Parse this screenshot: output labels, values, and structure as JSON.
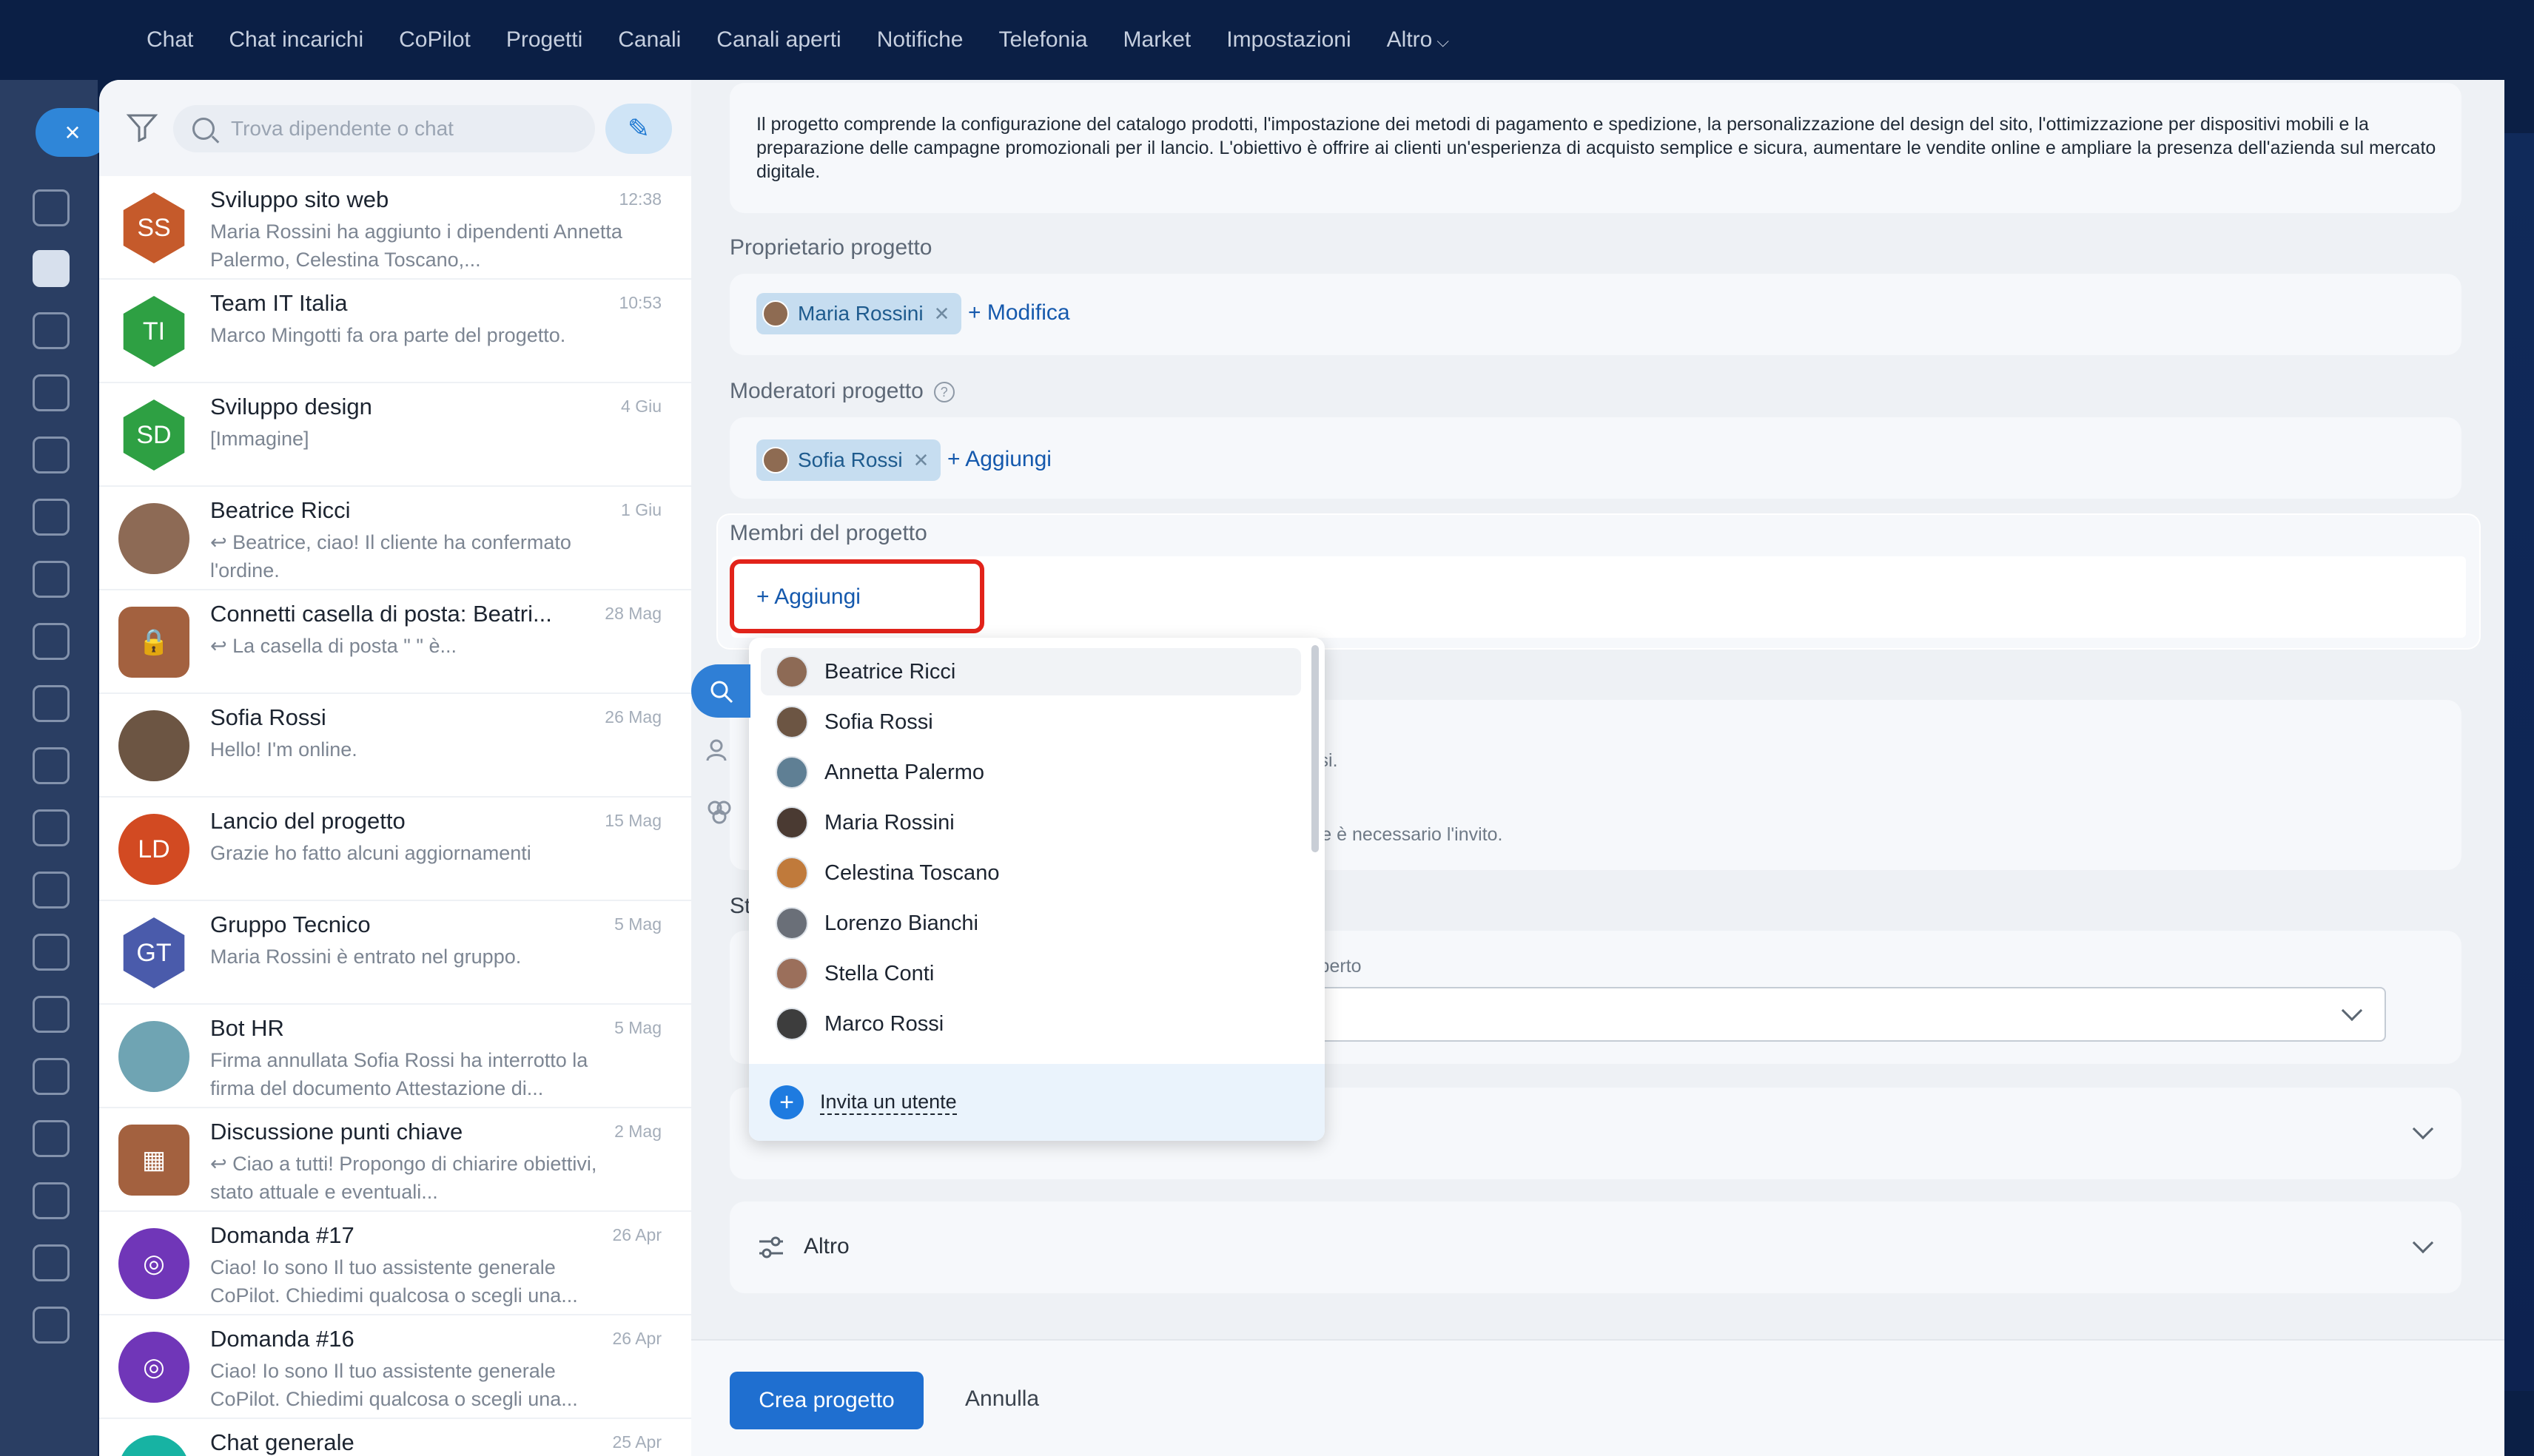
{
  "nav": {
    "items": [
      "Chat",
      "Chat incarichi",
      "CoPilot",
      "Progetti",
      "Canali",
      "Canali aperti",
      "Notifiche",
      "Telefonia",
      "Market",
      "Impostazioni",
      "Altro"
    ]
  },
  "rail": {
    "close": "×"
  },
  "search": {
    "placeholder": "Trova dipendente o chat"
  },
  "chats": [
    {
      "initials": "SS",
      "title": "Sviluppo sito web",
      "time": "12:38",
      "preview": "Maria Rossini ha aggiunto i dipendenti Annetta Palermo, Celestina Toscano,...",
      "color": "#c55a2b",
      "shape": "hex"
    },
    {
      "initials": "TI",
      "title": "Team IT Italia",
      "time": "10:53",
      "preview": "Marco Mingotti fa ora parte del progetto.",
      "color": "#2ea043",
      "shape": "hex"
    },
    {
      "initials": "SD",
      "title": "Sviluppo design",
      "time": "4 Giu",
      "preview": "[Immagine]",
      "color": "#2ea043",
      "shape": "hex"
    },
    {
      "initials": "",
      "title": "Beatrice Ricci",
      "time": "1 Giu",
      "preview": "↩ Beatrice, ciao! Il cliente ha confermato l'ordine.",
      "color": "#8d6a55",
      "shape": "circle"
    },
    {
      "initials": "🔒",
      "title": "Connetti casella di posta: Beatri...",
      "time": "28 Mag",
      "preview": "↩ La casella di posta \"                                   \" è...",
      "color": "#a3613f",
      "shape": "square"
    },
    {
      "initials": "",
      "title": "Sofia Rossi",
      "time": "26 Mag",
      "preview": "Hello! I'm online.",
      "color": "#6c5543",
      "shape": "circle"
    },
    {
      "initials": "LD",
      "title": "Lancio del progetto",
      "time": "15 Mag",
      "preview": "Grazie ho fatto alcuni aggiornamenti",
      "color": "#d24a22",
      "shape": "circle"
    },
    {
      "initials": "GT",
      "title": "Gruppo Tecnico",
      "time": "5 Mag",
      "preview": "Maria Rossini è entrato nel gruppo.",
      "color": "#4a5bab",
      "shape": "hex"
    },
    {
      "initials": "",
      "title": "Bot HR",
      "time": "5 Mag",
      "preview": "Firma annullata Sofia Rossi ha interrotto la firma del documento Attestazione di...",
      "color": "#6fa4b3",
      "shape": "circle"
    },
    {
      "initials": "▦",
      "title": "Discussione punti chiave",
      "time": "2 Mag",
      "preview": "↩ Ciao a tutti! Propongo di chiarire obiettivi, stato attuale e eventuali...",
      "color": "#a3613f",
      "shape": "square"
    },
    {
      "initials": "◎",
      "title": "Domanda #17",
      "time": "26 Apr",
      "preview": "Ciao! Io sono Il tuo assistente generale CoPilot. Chiedimi qualcosa o scegli una...",
      "color": "#7036b8",
      "shape": "circle"
    },
    {
      "initials": "◎",
      "title": "Domanda #16",
      "time": "26 Apr",
      "preview": "Ciao! Io sono Il tuo assistente generale CoPilot. Chiedimi qualcosa o scegli una...",
      "color": "#7036b8",
      "shape": "circle"
    },
    {
      "initials": "",
      "title": "Chat generale",
      "time": "25 Apr",
      "preview": "",
      "color": "#17b3a3",
      "shape": "circle"
    }
  ],
  "form": {
    "description": "Il progetto comprende la configurazione del catalogo prodotti, l'impostazione dei metodi di pagamento e spedizione, la personalizzazione del design del sito, l'ottimizzazione per dispositivi mobili e la preparazione delle campagne promozionali per il lancio. L'obiettivo è offrire ai clienti un'esperienza di acquisto semplice e sicura, aumentare le vendite online e ampliare la presenza dell'azienda sul mercato digitale.",
    "owner_label": "Proprietario progetto",
    "owner_name": "Maria Rossini",
    "owner_edit": "+ Modifica",
    "moderators_label": "Moderatori progetto",
    "moderator_name": "Sofia Rossi",
    "moderator_add": "+ Aggiungi",
    "members_label": "Membri del progetto",
    "members_add": "+ Aggiungi",
    "hidden_text_1": "ò unirsi.",
    "hidden_text_2": "entrare è necessario l'invito.",
    "hidden_text_3": "ene aperto",
    "hidden_st": "St",
    "more_label": "Altro",
    "create_btn": "Crea progetto",
    "cancel_btn": "Annulla"
  },
  "dropdown": {
    "users": [
      "Beatrice Ricci",
      "Sofia Rossi",
      "Annetta Palermo",
      "Maria Rossini",
      "Celestina Toscano",
      "Lorenzo Bianchi",
      "Stella Conti",
      "Marco Rossi"
    ],
    "invite": "Invita un utente"
  },
  "colors": {
    "accent": "#1f6fd0",
    "highlight": "#e2231a",
    "nav_bg": "#0b1f45"
  }
}
